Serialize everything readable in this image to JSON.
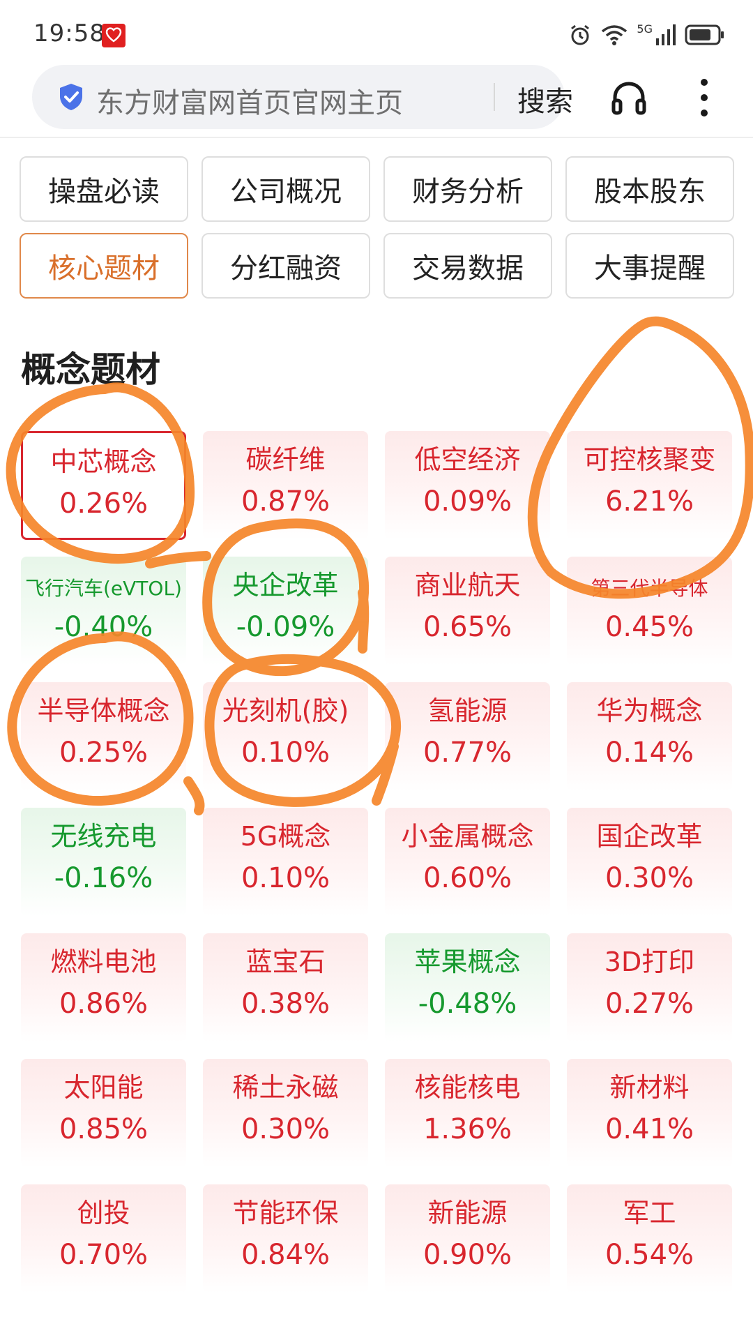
{
  "status_bar": {
    "time": "19:58",
    "network_label": "5G",
    "battery_icon": "battery-icon",
    "wifi_icon": "wifi-icon",
    "alarm_icon": "alarm-icon"
  },
  "search": {
    "query": "东方财富网首页官网主页",
    "button_label": "搜索",
    "shield_icon": "shield-check-icon"
  },
  "toolbar": {
    "headphone_icon": "headphone-icon",
    "more_icon": "more-vertical-icon"
  },
  "tabs": [
    {
      "label": "操盘必读",
      "active": false
    },
    {
      "label": "公司概况",
      "active": false
    },
    {
      "label": "财务分析",
      "active": false
    },
    {
      "label": "股本股东",
      "active": false
    },
    {
      "label": "核心题材",
      "active": true
    },
    {
      "label": "分红融资",
      "active": false
    },
    {
      "label": "交易数据",
      "active": false
    },
    {
      "label": "大事提醒",
      "active": false
    }
  ],
  "section_title": "概念题材",
  "concepts": [
    {
      "name": "中芯概念",
      "change": "0.26%",
      "direction": "up",
      "selected": true
    },
    {
      "name": "碳纤维",
      "change": "0.87%",
      "direction": "up"
    },
    {
      "name": "低空经济",
      "change": "0.09%",
      "direction": "up"
    },
    {
      "name": "可控核聚变",
      "change": "6.21%",
      "direction": "up"
    },
    {
      "name": "飞行汽车(eVTOL)",
      "change": "-0.40%",
      "direction": "down"
    },
    {
      "name": "央企改革",
      "change": "-0.09%",
      "direction": "down"
    },
    {
      "name": "商业航天",
      "change": "0.65%",
      "direction": "up"
    },
    {
      "name": "第三代半导体",
      "change": "0.45%",
      "direction": "up"
    },
    {
      "name": "半导体概念",
      "change": "0.25%",
      "direction": "up"
    },
    {
      "name": "光刻机(胶)",
      "change": "0.10%",
      "direction": "up"
    },
    {
      "name": "氢能源",
      "change": "0.77%",
      "direction": "up"
    },
    {
      "name": "华为概念",
      "change": "0.14%",
      "direction": "up"
    },
    {
      "name": "无线充电",
      "change": "-0.16%",
      "direction": "down"
    },
    {
      "name": "5G概念",
      "change": "0.10%",
      "direction": "up"
    },
    {
      "name": "小金属概念",
      "change": "0.60%",
      "direction": "up"
    },
    {
      "name": "国企改革",
      "change": "0.30%",
      "direction": "up"
    },
    {
      "name": "燃料电池",
      "change": "0.86%",
      "direction": "up"
    },
    {
      "name": "蓝宝石",
      "change": "0.38%",
      "direction": "up"
    },
    {
      "name": "苹果概念",
      "change": "-0.48%",
      "direction": "down"
    },
    {
      "name": "3D打印",
      "change": "0.27%",
      "direction": "up"
    },
    {
      "name": "太阳能",
      "change": "0.85%",
      "direction": "up"
    },
    {
      "name": "稀土永磁",
      "change": "0.30%",
      "direction": "up"
    },
    {
      "name": "核能核电",
      "change": "1.36%",
      "direction": "up"
    },
    {
      "name": "新材料",
      "change": "0.41%",
      "direction": "up"
    },
    {
      "name": "创投",
      "change": "0.70%",
      "direction": "up"
    },
    {
      "name": "节能环保",
      "change": "0.84%",
      "direction": "up"
    },
    {
      "name": "新能源",
      "change": "0.90%",
      "direction": "up"
    },
    {
      "name": "军工",
      "change": "0.54%",
      "direction": "up"
    }
  ],
  "colors": {
    "up": "#d8262e",
    "down": "#16992e",
    "active_tab": "#d96f2a",
    "annotation": "#f5862a"
  }
}
